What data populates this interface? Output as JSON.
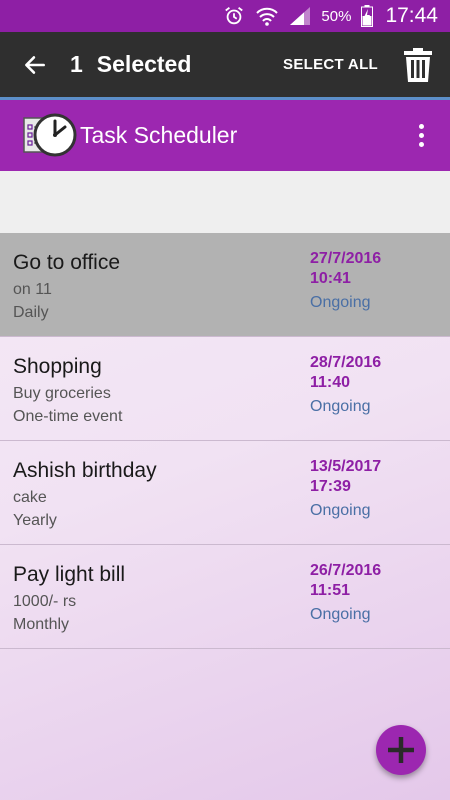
{
  "status_bar": {
    "battery_percent": "50%",
    "time": "17:44",
    "icons": [
      "alarm-icon",
      "wifi-icon",
      "signal-icon",
      "battery-charging-icon"
    ]
  },
  "action_mode": {
    "selected_count": "1",
    "selected_label": "Selected",
    "select_all_label": "SELECT ALL",
    "icons": [
      "back-arrow-icon",
      "trash-icon"
    ]
  },
  "app_bar": {
    "title": "Task Scheduler",
    "icons": [
      "clock-checklist-logo",
      "overflow-menu-icon"
    ]
  },
  "tasks": [
    {
      "title": "Go to office",
      "description": "on 11",
      "frequency": "Daily",
      "date": "27/7/2016",
      "time": "10:41",
      "status": "Ongoing",
      "selected": true
    },
    {
      "title": "Shopping",
      "description": "Buy groceries",
      "frequency": "One-time event",
      "date": "28/7/2016",
      "time": "11:40",
      "status": "Ongoing",
      "selected": false
    },
    {
      "title": "Ashish birthday",
      "description": "cake",
      "frequency": "Yearly",
      "date": "13/5/2017",
      "time": "17:39",
      "status": "Ongoing",
      "selected": false
    },
    {
      "title": "Pay light bill",
      "description": "1000/- rs",
      "frequency": "Monthly",
      "date": "26/7/2016",
      "time": "11:51",
      "status": "Ongoing",
      "selected": false
    }
  ],
  "fab": {
    "icon": "plus-icon"
  },
  "colors": {
    "primary": "#9c27b0",
    "primary_dark": "#8e1fa5",
    "action_mode_bg": "#2f2f2f",
    "selected_row": "#b2b2b2",
    "status_text": "#4a6fa5"
  }
}
